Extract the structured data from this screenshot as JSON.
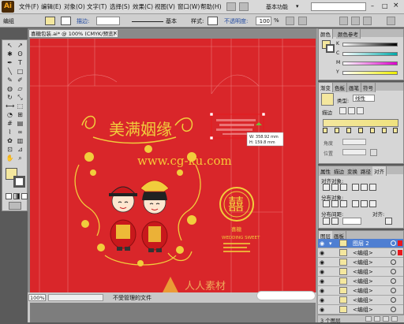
{
  "app": {
    "logo": "Ai",
    "workspace": "基本功能"
  },
  "menu": [
    "文件(F)",
    "编辑(E)",
    "对象(O)",
    "文字(T)",
    "选择(S)",
    "效果(C)",
    "视图(V)",
    "窗口(W)",
    "帮助(H)"
  ],
  "control": {
    "mode_label": "编组",
    "stroke_label": "描边:",
    "profile_label": "基本",
    "style_label": "样式:",
    "opacity_label": "不透明度:",
    "opacity_value": "100",
    "opacity_unit": "%"
  },
  "document": {
    "tab_title": "喜糖包装.ai* @ 100% (CMYK/预览)",
    "zoom": "100%",
    "status_text": "不受管理的文件"
  },
  "artwork": {
    "title": "美满姻缘",
    "watermark": "www.cg-ku.com",
    "xi": "囍",
    "product_name": "喜糖",
    "subtitle": "WEDDING SWEET",
    "measure_w": "W: 358.92 mm",
    "measure_h": "H: 159.8 mm",
    "bottom_watermark": "人人素材"
  },
  "color_panel": {
    "tabs": [
      "颜色",
      "颜色参考"
    ],
    "channels": [
      "K",
      "C",
      "M",
      "Y"
    ]
  },
  "gradient_panel": {
    "tabs": [
      "渐变",
      "色板",
      "画笔",
      "符号"
    ],
    "type_label": "类型:",
    "type_value": "线性",
    "stroke_label": "描边",
    "angle_label": "角度",
    "location_label": "位置"
  },
  "align_panel": {
    "tabs": [
      "属性",
      "描边",
      "变换",
      "路径",
      "对齐"
    ],
    "align_objects": "对齐对象:",
    "distribute_objects": "分布对象:",
    "distribute_spacing": "分布间距:",
    "align_to": "对齐:"
  },
  "layers_panel": {
    "tabs": [
      "图层",
      "画板"
    ],
    "top_layer": "图层 2",
    "items": [
      "<编组>",
      "<编组>",
      "<编组>",
      "<编组>",
      "<编组>",
      "<编组>",
      "<编组>",
      "<编组>"
    ],
    "footer": "3 个图层"
  },
  "colors": {
    "artboard_red": "#d9262a",
    "gold": "#f1cd3c",
    "selection_red": "#e8171d"
  }
}
